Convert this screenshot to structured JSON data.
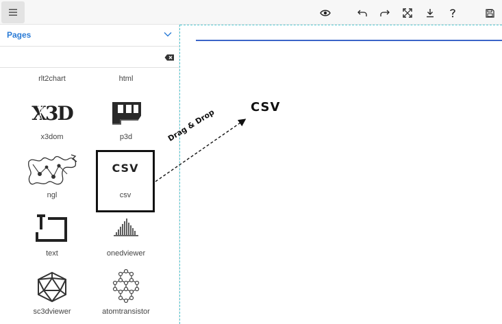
{
  "panel": {
    "title": "Pages",
    "search": {
      "value": "",
      "placeholder": ""
    }
  },
  "tiles": [
    {
      "label": "rlt2chart",
      "icon": "rlt2chart-icon"
    },
    {
      "label": "html",
      "icon": "html-icon"
    },
    {
      "label": "x3dom",
      "icon": "x3d-logo-icon"
    },
    {
      "label": "p3d",
      "icon": "p3d-block-icon"
    },
    {
      "label": "ngl",
      "icon": "ngl-molecule-icon"
    },
    {
      "label": "csv",
      "icon_text": "CSV"
    },
    {
      "label": "text",
      "icon": "text-box-icon"
    },
    {
      "label": "onedviewer",
      "icon": "waveform-bars-icon"
    },
    {
      "label": "sc3dviewer",
      "icon": "icosahedron-icon"
    },
    {
      "label": "atomtransistor",
      "icon": "hexagon-lattice-icon"
    }
  ],
  "toolbar": {
    "icons": [
      "menu-icon",
      "eye-icon",
      "undo-icon",
      "redo-icon",
      "fullscreen-icon",
      "download-icon",
      "help-icon",
      "save-icon"
    ]
  },
  "canvas": {
    "dropped_label": "CSV",
    "drag_hint": "Drag & Drop"
  },
  "colors": {
    "accent": "#2a7bd6",
    "rule": "#3a64c8",
    "guide": "#4fc8d3"
  }
}
